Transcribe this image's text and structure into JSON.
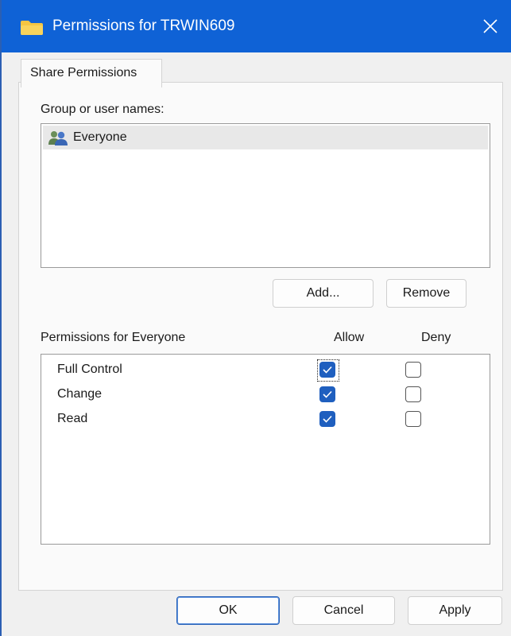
{
  "window": {
    "title": "Permissions for TRWIN609",
    "title_bar_color": "#0f62d6",
    "accent_color": "#1f5fbf"
  },
  "tabs": [
    {
      "label": "Share Permissions",
      "selected": true
    }
  ],
  "groups_section": {
    "label": "Group or user names:",
    "items": [
      {
        "name": "Everyone",
        "icon": "users-group-icon",
        "selected": true
      }
    ]
  },
  "buttons": {
    "add": "Add...",
    "remove": "Remove"
  },
  "permissions_section": {
    "label": "Permissions for Everyone",
    "allow_header": "Allow",
    "deny_header": "Deny",
    "rows": [
      {
        "name": "Full Control",
        "allow": true,
        "deny": false,
        "focused": true
      },
      {
        "name": "Change",
        "allow": true,
        "deny": false,
        "focused": false
      },
      {
        "name": "Read",
        "allow": true,
        "deny": false,
        "focused": false
      }
    ]
  },
  "footer": {
    "ok": "OK",
    "cancel": "Cancel",
    "apply": "Apply"
  }
}
